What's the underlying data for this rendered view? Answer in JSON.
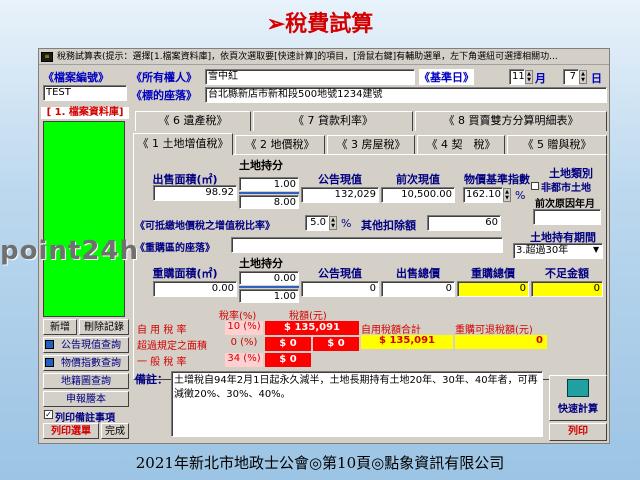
{
  "slide": {
    "arrow": "➢",
    "title": "稅費試算",
    "footer": "2021年新北市地政士公會◎第10頁◎點象資訊有限公司",
    "watermark": "point24h"
  },
  "window": {
    "title": "稅務試算表(提示：選擇[1.檔案資料庫]，依頁次選取要[快速計算]的項目，[滑鼠右鍵]有輔助選單，左下角選紐可選擇相關功..."
  },
  "header": {
    "case_no_label": "《檔案編號》",
    "case_no_value": "TEST",
    "owner_label": "《所有權人》",
    "owner_value": "雪中紅",
    "base_date_label": "《基準日》",
    "month_value": "11",
    "month_unit": "月",
    "day_value": "7",
    "day_unit": "日",
    "location_label": "《標的座落》",
    "location_value": "台北縣新店市新和段500地號1234建號"
  },
  "left_panel": {
    "db_title": "[ 1. 檔案資料庫]",
    "buttons": {
      "add": "新增",
      "delete": "刪除記錄",
      "land_value_query": "公告現值查詢",
      "price_index_query": "物價指數查詢",
      "map_query": "地籍圖查詢",
      "declaration": "申報謄本",
      "print_menu": "列印選單",
      "done": "完成"
    },
    "print_notes_checkbox": "列印備註事項"
  },
  "tabs": {
    "row1": [
      "《 6 遺產稅》",
      "《 7 貸款利率》",
      "《 8 買賣雙方分算明細表》"
    ],
    "row2": [
      "《 1 土地增值稅》",
      "《 2 地價稅》",
      "《 3 房屋稅》",
      "《 4 契　稅》",
      "《 5 贈與稅》"
    ]
  },
  "land_tax": {
    "sale_area_label": "出售面積(㎡)",
    "sale_area": "98.92",
    "holding_label": "土地持分",
    "holding_num": "1.00",
    "holding_den": "8.00",
    "present_value_label": "公告現值",
    "present_value": "132,029",
    "prev_value_label": "前次現值",
    "prev_value": "10,500.00",
    "price_index_label": "物價基準指數",
    "price_index": "162.10",
    "pct": "%",
    "land_type_label": "土地類別",
    "non_urban_label": "非都市土地",
    "prev_year_label": "前次原因年月",
    "deduct_ratio_label": "《可抵繳地價稅之增值稅比率》",
    "deduct_ratio": "5.0",
    "deduct_pct": "%",
    "other_deduct_label": "其他扣除額",
    "other_deduct": "60",
    "holding_period_label": "土地持有期間",
    "holding_period": "3.超過30年",
    "repurchase_location_label": "《重購區的座落》",
    "repurchase_area_label": "重購面積(㎡)",
    "repurchase_area": "0.00",
    "repurchase_holding_label": "土地持分",
    "rep_holding_num": "0.00",
    "rep_holding_den": "1.00",
    "rep_present_value_label": "公告現值",
    "rep_present_value": "0",
    "sale_total_label": "出售總價",
    "sale_total": "0",
    "rep_total_label": "重購總價",
    "rep_total": "0",
    "shortfall_label": "不足金額",
    "shortfall": "0"
  },
  "results": {
    "rate_header": "稅率(%)",
    "tax_header": "稅額(元)",
    "self_use_label": "自 用 稅 率",
    "self_use_rate": "10 (%)",
    "self_use_tax": "$ 135,091",
    "self_use_total_label": "自用稅額合計",
    "self_use_total": "$ 135,091",
    "refund_label": "重購可退稅額(元)",
    "refund": "0",
    "excess_label": "超過規定之面積",
    "excess_rate": "0 (%)",
    "excess_tax": "$ 0",
    "excess_tax2": "$ 0",
    "general_label": "一 般 稅 率",
    "general_rate": "34 (%)",
    "general_tax": "$ 0"
  },
  "notes": {
    "label": "備註：",
    "text": "土增稅自94年2月1日起永久減半，土地長期持有土地20年、30年、40年者，可再減徵20%、30%、40%。"
  },
  "actions": {
    "quick_calc": "快速計算",
    "print": "列印"
  },
  "colors": {
    "accent_red": "#d40000",
    "highlight": "#ffff00",
    "label_blue": "#0000c0"
  }
}
